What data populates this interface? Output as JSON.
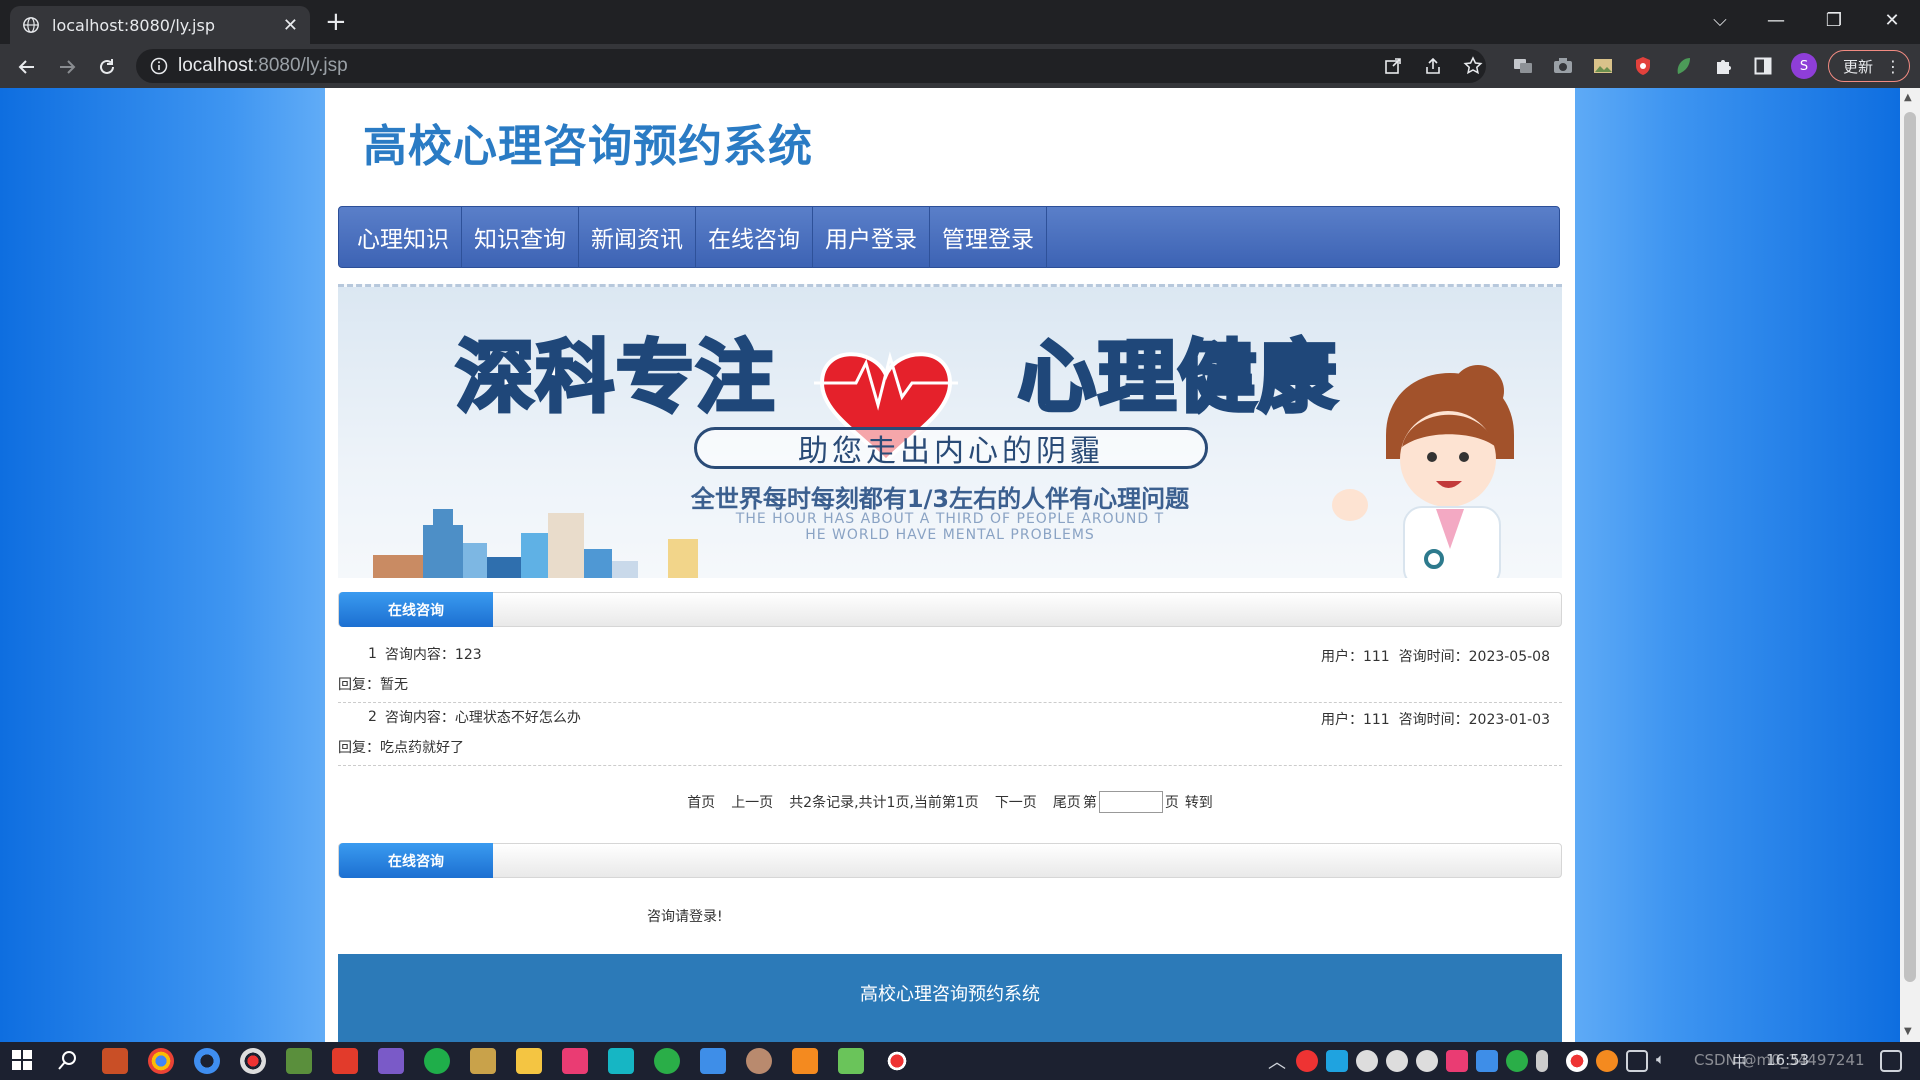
{
  "browser": {
    "tab_title": "localhost:8080/ly.jsp",
    "url_host": "localhost",
    "url_rest": ":8080/ly.jsp",
    "profile_initial": "S",
    "update_label": "更新"
  },
  "site": {
    "title": "高校心理咨询预约系统",
    "nav": [
      "心理知识",
      "知识查询",
      "新闻资讯",
      "在线咨询",
      "用户登录",
      "管理登录"
    ]
  },
  "banner": {
    "heading_left": "深科专注",
    "heading_right": "心理健康",
    "pill": "助您走出内心的阴霾",
    "line_cn": "全世界每时每刻都有1/3左右的人伴有心理问题",
    "line_en_1": "THE HOUR HAS ABOUT A THIRD OF PEOPLE AROUND T",
    "line_en_2": "HE WORLD HAVE MENTAL PROBLEMS"
  },
  "consult_section": {
    "tab_label": "在线咨询",
    "entries": [
      {
        "num": "1",
        "content": "咨询内容：123",
        "user": "用户：111",
        "time": "咨询时间：2023-05-08",
        "reply": "回复：暂无"
      },
      {
        "num": "2",
        "content": "咨询内容：心理状态不好怎么办",
        "user": "用户：111",
        "time": "咨询时间：2023-01-03",
        "reply": "回复：吃点药就好了"
      }
    ]
  },
  "pager": {
    "first": "首页",
    "prev": "上一页",
    "summary": "共2条记录,共计1页,当前第1页",
    "next": "下一页",
    "last": "尾页",
    "page_prefix": "第",
    "page_suffix": "页",
    "goto": "转到"
  },
  "form_section": {
    "tab_label": "在线咨询",
    "login_note": "咨询请登录!"
  },
  "footer": {
    "text": "高校心理咨询预约系统"
  },
  "taskbar": {
    "clock": "16:53",
    "ime": "中",
    "watermark": "CSDN @m0_34497241"
  },
  "colors": {
    "title_blue": "#2a7bc4",
    "nav_blue": "#4a70be",
    "footer_blue": "#2c7ab8",
    "tab_blue": "#1c6fd1"
  }
}
